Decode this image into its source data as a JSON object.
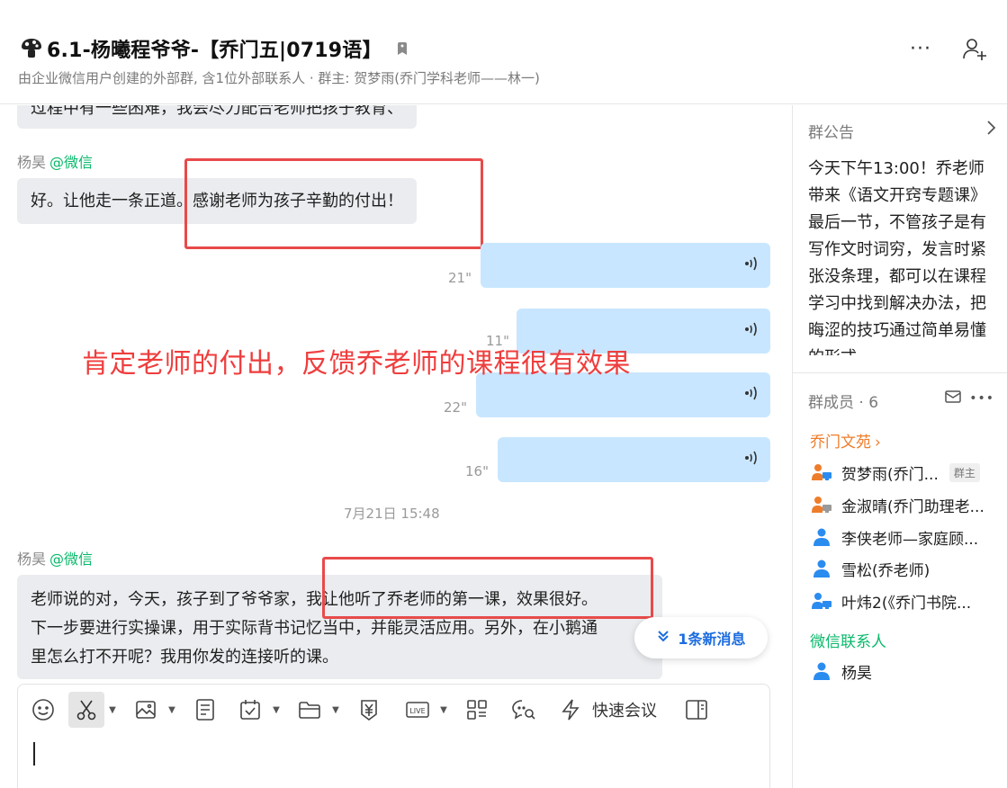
{
  "window": {
    "controls": {
      "minimize": "—",
      "restore": "❐",
      "close": "✕"
    }
  },
  "header": {
    "title": "6.1-杨曦程爷爷-【乔门五|0719语】",
    "subtitle": "由企业微信用户创建的外部群, 含1位外部联系人 · 群主: 贺梦雨(乔门学科老师——林一)",
    "more_label": "···"
  },
  "chat": {
    "top_cut_message": "过程中有一些困难，我会尽力配合老师把孩子教育、",
    "messages": [
      {
        "sender": "杨昊",
        "sender_suffix": "@微信",
        "text": "好。让他走一条正道。感谢老师为孩子辛勤的付出！"
      },
      {
        "sender": "杨昊",
        "sender_suffix": "@微信",
        "lines": [
          "老师说的对，今天，孩子到了爷爷家，我让他听了乔老师的第一课，效果很好。",
          "下一步要进行实操课，用于实际背书记忆当中，并能灵活应用。另外，在小鹅通",
          "里怎么打不开呢？我用你发的连接听的课。"
        ]
      }
    ],
    "voice_messages": [
      {
        "duration": "21\""
      },
      {
        "duration": "11\""
      },
      {
        "duration": "22\""
      },
      {
        "duration": "16\""
      }
    ],
    "timestamp": "7月21日 15:48",
    "annotation": "肯定老师的付出，反馈乔老师的课程很有效果",
    "new_messages_label": "1条新消息"
  },
  "composer": {
    "quick_meeting_label": "快速会议",
    "toolbar_icons": [
      "emoji-icon",
      "scissors-icon",
      "image-icon",
      "document-icon",
      "calendar-check-icon",
      "folder-icon",
      "yen-icon",
      "live-icon",
      "apps-grid-icon",
      "chat-search-icon",
      "lightning-icon",
      "sidebar-toggle-icon"
    ]
  },
  "right_panel": {
    "notice_title": "群公告",
    "notice_text": "今天下午13:00！乔老师带来《语文开窍专题课》最后一节，不管孩子是有写作文时词穷，发言时紧张没条理，都可以在课程学习中找到解决办法，把晦涩的技巧通过简单易懂的形式",
    "members_title": "群成员 · 6",
    "section_company": "乔门文苑",
    "members": [
      {
        "name": "贺梦雨(乔门...",
        "badge": "群主"
      },
      {
        "name": "金淑晴(乔门助理老..."
      },
      {
        "name": "李侠老师—家庭顾..."
      },
      {
        "name": "雪松(乔老师)"
      },
      {
        "name": "叶炜2(《乔门书院..."
      }
    ],
    "section_wechat": "微信联系人",
    "wechat_members": [
      {
        "name": "杨昊"
      }
    ]
  },
  "colors": {
    "accent_blue": "#1b6ce0",
    "voice_bubble": "#c8e6ff",
    "wechat_green": "#07b96a",
    "company_orange": "#ee7d2b",
    "annotation_red": "#ef3d3d"
  }
}
